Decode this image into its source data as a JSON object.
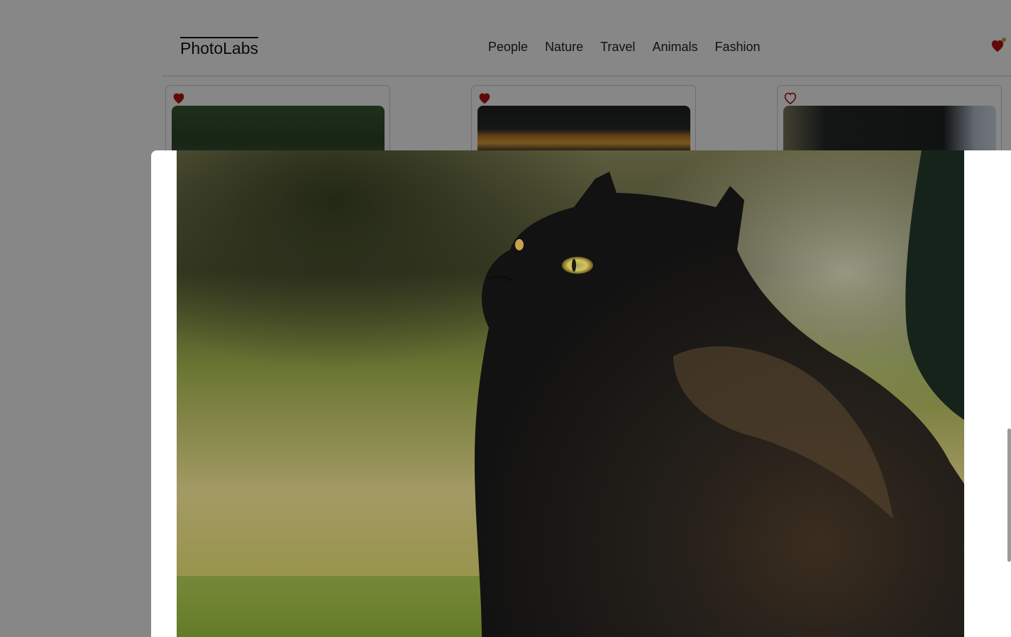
{
  "app": {
    "logo": "PhotoLabs"
  },
  "topics": [
    "People",
    "Nature",
    "Travel",
    "Animals",
    "Fashion"
  ],
  "favourites": {
    "icon": "heart-icon",
    "has_notification": true
  },
  "photo_cards": [
    {
      "liked": true,
      "subject": "forest-photo"
    },
    {
      "liked": true,
      "subject": "street-market-photo"
    },
    {
      "liked": false,
      "subject": "dog-photo"
    }
  ],
  "modal": {
    "photo": "black-cat-photo"
  },
  "colors": {
    "heart": "#b31412",
    "overlay": "rgba(0,0,0,0.47)",
    "notification_dot": "#c9a227"
  }
}
